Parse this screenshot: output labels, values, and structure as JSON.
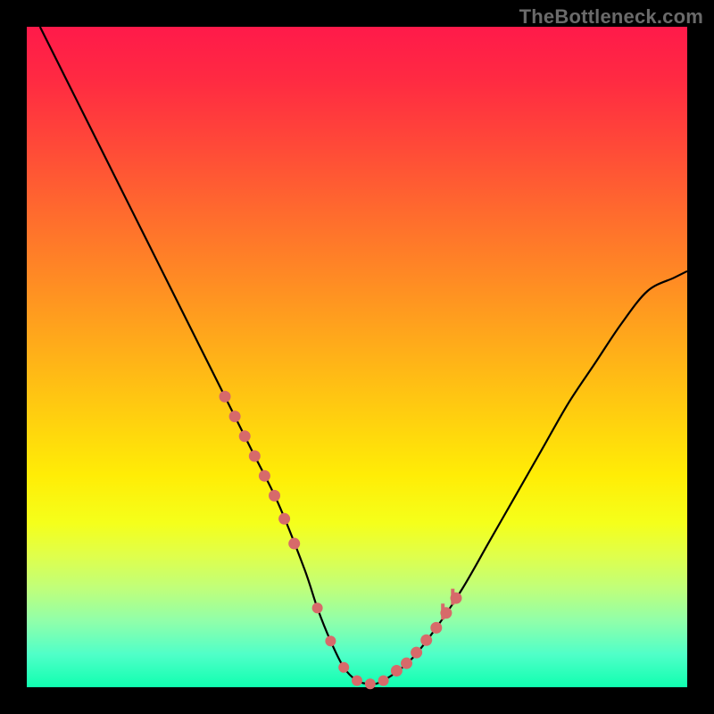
{
  "watermark": "TheBottleneck.com",
  "chart_data": {
    "type": "line",
    "title": "",
    "xlabel": "",
    "ylabel": "",
    "xlim": [
      0,
      100
    ],
    "ylim": [
      0,
      100
    ],
    "grid": false,
    "legend": false,
    "series": [
      {
        "name": "bottleneck-curve",
        "x": [
          2,
          6,
          10,
          14,
          18,
          22,
          26,
          30,
          34,
          38,
          42,
          44,
          46,
          48,
          50,
          52,
          54,
          58,
          62,
          66,
          70,
          74,
          78,
          82,
          86,
          90,
          94,
          98,
          100
        ],
        "y": [
          100,
          92,
          84,
          76,
          68,
          60,
          52,
          44,
          36,
          28,
          18,
          12,
          7,
          3,
          1,
          0.5,
          1,
          4,
          9,
          15,
          22,
          29,
          36,
          43,
          49,
          55,
          60,
          62,
          63
        ]
      }
    ],
    "markers": {
      "left_cluster_x": [
        30,
        31.5,
        33,
        34.5,
        36,
        37.5,
        39,
        40.5
      ],
      "bottom_cluster_x": [
        44,
        46,
        48,
        50,
        52,
        54
      ],
      "right_cluster_x": [
        56,
        57.5,
        59,
        60.5,
        62,
        63.5,
        65
      ],
      "right_bars_x": [
        63,
        64.5
      ]
    },
    "colors": {
      "curve": "#000000",
      "marker": "#d76a6a",
      "gradient_top": "#ff1a4a",
      "gradient_bottom": "#10ffb0"
    }
  }
}
